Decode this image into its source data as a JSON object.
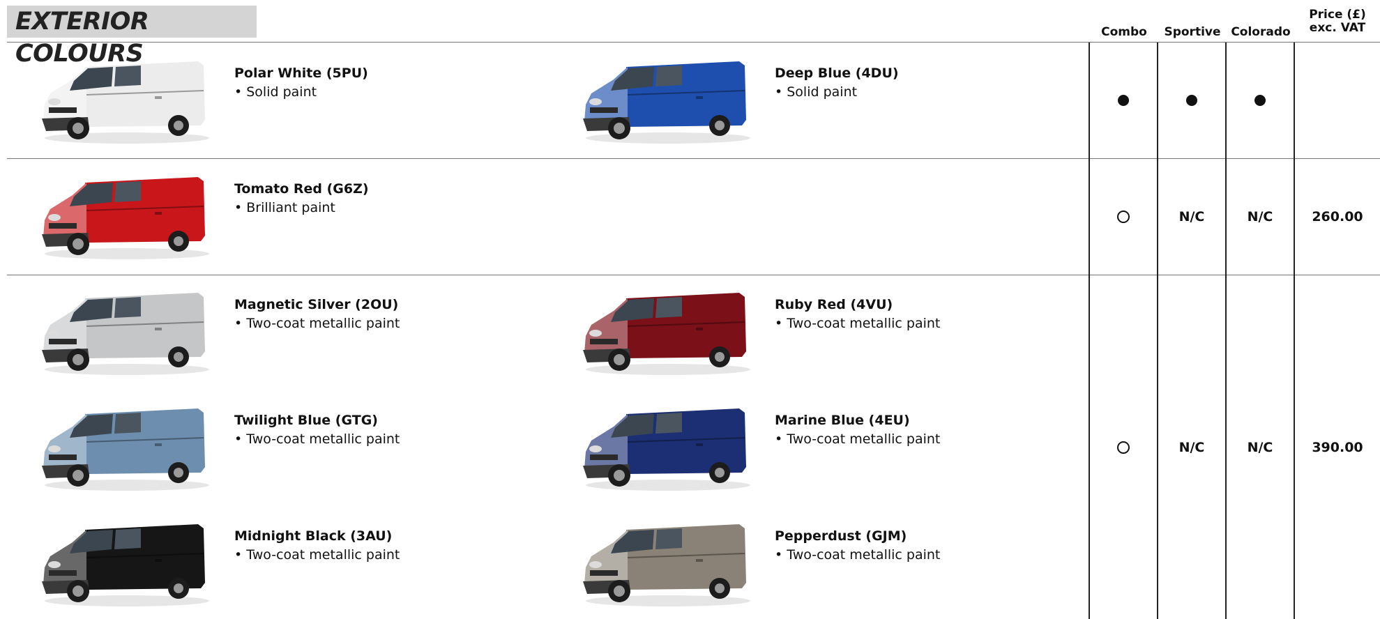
{
  "page": {
    "title": "EXTERIOR COLOURS"
  },
  "columns": {
    "combo": "Combo",
    "sportive": "Sportive",
    "colorado": "Colorado",
    "price_line1": "Price (£)",
    "price_line2": "exc. VAT"
  },
  "groups": [
    {
      "combo": "standard-dot",
      "sportive": "standard-dot",
      "colorado": "standard-dot",
      "price": ""
    },
    {
      "combo": "option-circle",
      "sportive": "N/C",
      "colorado": "N/C",
      "price": "260.00"
    },
    {
      "combo": "option-circle",
      "sportive": "N/C",
      "colorado": "N/C",
      "price": "390.00"
    }
  ],
  "colours": [
    {
      "name": "Polar White (5PU)",
      "desc": "• Solid paint",
      "body_color": "#ececec"
    },
    {
      "name": "Deep Blue (4DU)",
      "desc": "• Solid paint",
      "body_color": "#1f4fae"
    },
    {
      "name": "Tomato Red (G6Z)",
      "desc": "• Brilliant paint",
      "body_color": "#c8161a"
    },
    {
      "name": "Magnetic Silver (2OU)",
      "desc": "• Two-coat metallic paint",
      "body_color": "#c5c6c8"
    },
    {
      "name": "Ruby Red (4VU)",
      "desc": "• Two-coat metallic paint",
      "body_color": "#7c1018"
    },
    {
      "name": "Twilight Blue (GTG)",
      "desc": "• Two-coat metallic paint",
      "body_color": "#6d8eae"
    },
    {
      "name": "Marine Blue (4EU)",
      "desc": "• Two-coat metallic paint",
      "body_color": "#1c2f74"
    },
    {
      "name": "Midnight Black (3AU)",
      "desc": "• Two-coat metallic paint",
      "body_color": "#161616"
    },
    {
      "name": "Pepperdust (GJM)",
      "desc": "• Two-coat metallic paint",
      "body_color": "#8a8276"
    }
  ]
}
